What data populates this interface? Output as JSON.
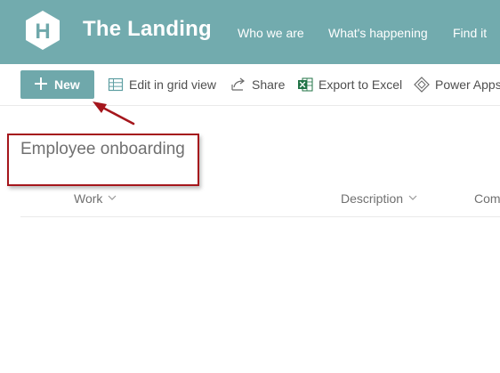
{
  "site": {
    "logo_letter": "H",
    "title": "The Landing",
    "nav": [
      "Who we are",
      "What's happening",
      "Find it"
    ]
  },
  "commandbar": {
    "new_label": "New",
    "edit_grid_label": "Edit in grid view",
    "share_label": "Share",
    "export_label": "Export to Excel",
    "power_apps_label": "Power Apps"
  },
  "list": {
    "title": "Employee onboarding",
    "columns": [
      "Work",
      "Description",
      "Com"
    ]
  },
  "colors": {
    "header_bg": "#72abae",
    "accent_button": "#6fa8ab",
    "annotation_red": "#a5161c",
    "excel_green": "#217346"
  }
}
